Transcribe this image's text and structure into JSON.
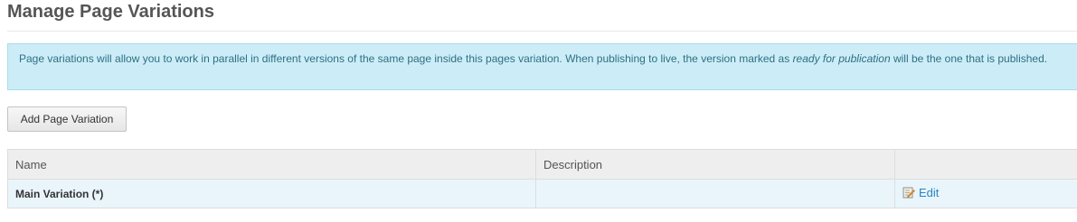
{
  "page_title": "Manage Page Variations",
  "info_box": {
    "text_before": "Page variations will allow you to work in parallel in different versions of the same page inside this pages variation. When publishing to live, the version marked as ",
    "text_emphasis": "ready for publication",
    "text_after": " will be the one that is published."
  },
  "toolbar": {
    "add_label": "Add Page Variation"
  },
  "table": {
    "columns": [
      "Name",
      "Description",
      ""
    ],
    "rows": [
      {
        "name": "Main Variation (*)",
        "description": "",
        "action_label": "Edit",
        "action_icon": "edit-icon"
      }
    ]
  },
  "colors": {
    "info_bg": "#ccedf8",
    "link": "#2a84c4",
    "row_bg": "#e9f5fb"
  }
}
